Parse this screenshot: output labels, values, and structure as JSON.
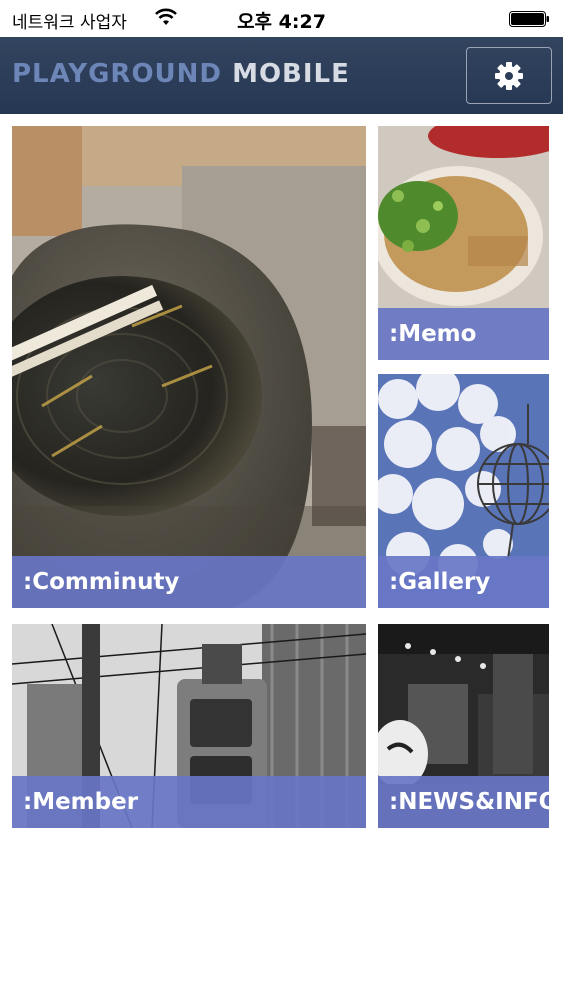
{
  "status_bar": {
    "carrier": "네트워크 사업자",
    "time": "오후 4:27"
  },
  "nav": {
    "title_light": "PLAYGROUND",
    "title_bold": "MOBILE",
    "settings_icon": "gear-icon",
    "colors": {
      "bar": "#2b3c58",
      "title_light": "#6d86b8",
      "title_bold": "#d7dbe3"
    }
  },
  "tiles": {
    "community": {
      "label": ":Comminuty",
      "image": "stone-bowl-photo"
    },
    "memo": {
      "label": ":Memo",
      "image": "ramen-bowl-photo"
    },
    "gallery": {
      "label": ":Gallery",
      "image": "sky-lantern-photo"
    },
    "member": {
      "label": ":Member",
      "image": "traffic-signal-photo"
    },
    "news": {
      "label": ":NEWS&INFO",
      "image": "night-street-lantern-photo"
    }
  },
  "label_color": "#6876c5"
}
